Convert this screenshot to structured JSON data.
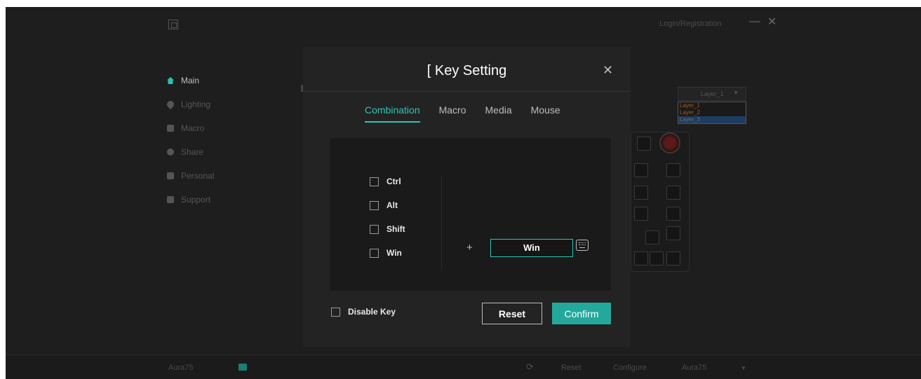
{
  "app": {
    "header": {
      "login_label": "Login/Registration",
      "minimize_glyph": "—",
      "close_glyph": "✕"
    },
    "sidebar": {
      "items": [
        {
          "label": "Main",
          "icon": "home-icon",
          "active": true
        },
        {
          "label": "Lighting",
          "icon": "bulb-icon"
        },
        {
          "label": "Macro",
          "icon": "macro-icon"
        },
        {
          "label": "Share",
          "icon": "share-icon"
        },
        {
          "label": "Personal",
          "icon": "user-icon"
        },
        {
          "label": "Support",
          "icon": "heart-icon"
        }
      ]
    },
    "layer": {
      "selected": "Layer_1",
      "options": [
        "Layer_1",
        "Layer_2",
        "Layer_3"
      ],
      "highlighted": "Layer_3"
    },
    "bottom_bar": {
      "device": "Aura75",
      "reset_label": "Reset",
      "configure_label": "Configure",
      "profile": "Aura75"
    }
  },
  "modal": {
    "title": "[ Key Setting",
    "tabs": [
      {
        "label": "Combination",
        "active": true
      },
      {
        "label": "Macro"
      },
      {
        "label": "Media"
      },
      {
        "label": "Mouse"
      }
    ],
    "modifiers": [
      {
        "label": "Ctrl",
        "checked": false
      },
      {
        "label": "Alt",
        "checked": false
      },
      {
        "label": "Shift",
        "checked": false
      },
      {
        "label": "Win",
        "checked": false
      }
    ],
    "plus": "+",
    "key_value": "Win",
    "disable_key_label": "Disable Key",
    "reset_label": "Reset",
    "confirm_label": "Confirm"
  },
  "colors": {
    "accent": "#2ec5b4",
    "confirm": "#23a99b",
    "background": "#1e1e1e",
    "modal": "#232323"
  }
}
